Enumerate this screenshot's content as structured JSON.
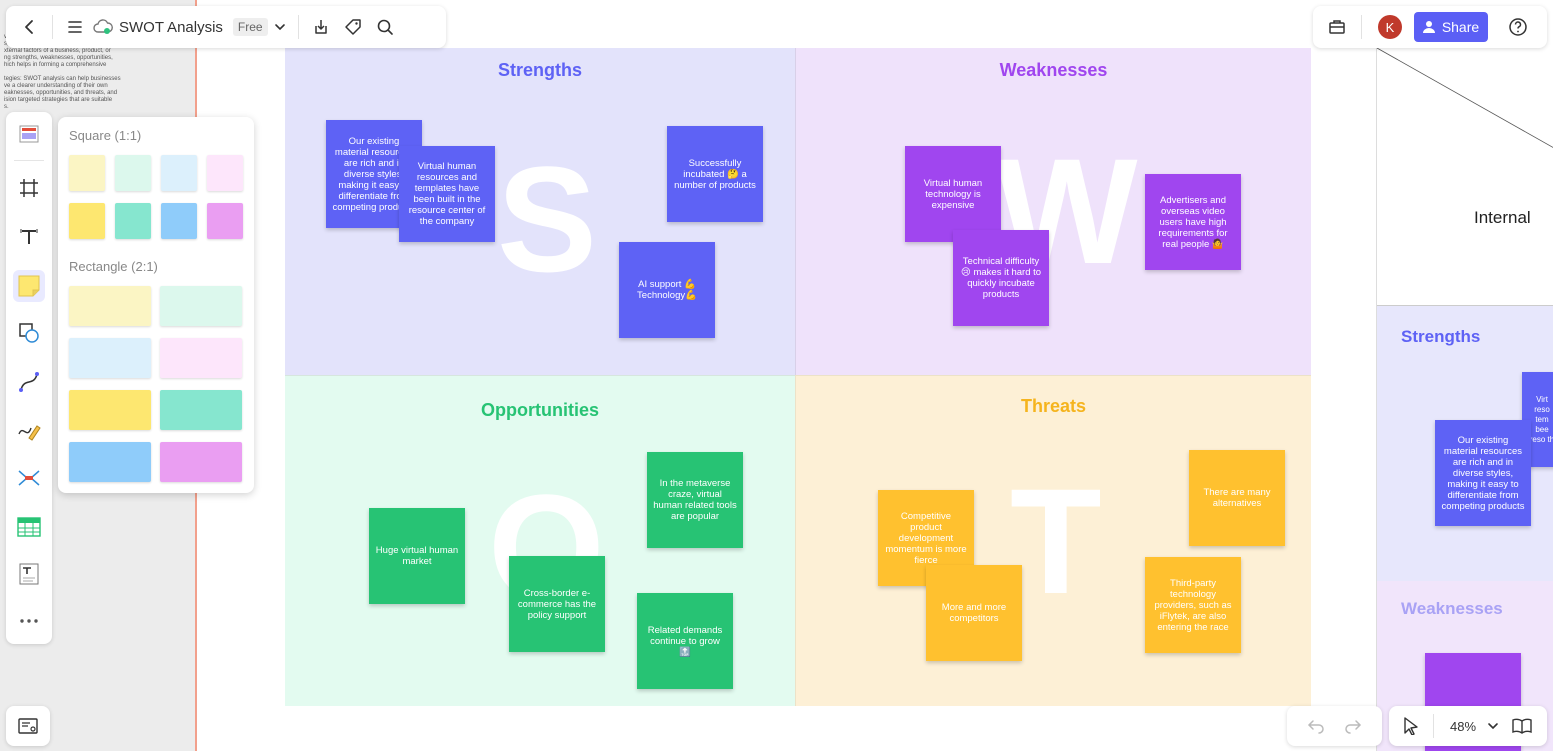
{
  "colors": {
    "accent": "#5b5ff5",
    "strengths_bg": "#e3e3fb",
    "weaknesses_bg": "#efe2fb",
    "opportunities_bg": "#e3fbf0",
    "threats_bg": "#fdf0d6",
    "strengths_note": "#5e62f5",
    "weaknesses_note": "#a046ef",
    "opportunities_note": "#27c374",
    "threats_note": "#ffc12f"
  },
  "doc_strip": {
    "lines": [
      "ve",
      "s,",
      "xternal factors of a business, product, or",
      "ng strengths, weaknesses, opportunities,",
      "hich helps in forming a comprehensive",
      "",
      "tegies: SWOT analysis can help businesses",
      "ve a clearer understanding of their own",
      "eaknesses, opportunities, and threats, and",
      "ision targeted strategies that are suitable",
      "s."
    ]
  },
  "topbar": {
    "title": "SWOT Analysis",
    "plan_badge": "Free",
    "icons": [
      "back-arrow-icon",
      "menu-icon",
      "cloud-sync-icon",
      "chevron-down-icon",
      "download-icon",
      "tag-icon",
      "search-icon"
    ]
  },
  "rightbar": {
    "avatar_initial": "K",
    "share_label": "Share"
  },
  "palette": {
    "square_title": "Square (1:1)",
    "rect_title": "Rectangle (2:1)",
    "square_colors": [
      "#fbf5c4",
      "#dcf8ed",
      "#dcf0fc",
      "#fde6fb",
      "#fde770",
      "#86e6cf",
      "#8fccfa",
      "#ea9ef2"
    ],
    "rect_colors": [
      "#fbf5c4",
      "#dcf8ed",
      "#dcf0fc",
      "#fde6fb",
      "#fde770",
      "#86e6cf",
      "#8fccfa",
      "#ea9ef2"
    ]
  },
  "quadrants": {
    "strengths": {
      "title": "Strengths",
      "letter": "S",
      "notes": [
        "Our existing material resources are rich and in diverse styles, making it easy to differentiate from competing products",
        "Virtual human resources and templates have been built in the resource center of the company",
        "Successfully incubated 🤔 a number of products",
        "AI support 💪Technology💪"
      ]
    },
    "weaknesses": {
      "title": "Weaknesses",
      "letter": "W",
      "notes": [
        "Virtual human technology is expensive",
        "Technical difficulty 😢 makes it hard to quickly incubate products",
        "Advertisers and overseas video users have high requirements for real people 🤷"
      ]
    },
    "opportunities": {
      "title": "Opportunities",
      "letter": "O",
      "notes": [
        "Huge virtual human market",
        "Cross-border e-commerce has the policy support",
        "In the metaverse craze, virtual human related tools are popular",
        "Related demands continue to grow 🔝"
      ]
    },
    "threats": {
      "title": "Threats",
      "letter": "T",
      "notes": [
        "Competitive product development momentum is more fierce",
        "More and more competitors",
        "There are many alternatives",
        "Third-party technology providers, such as iFlytek, are also entering the race"
      ]
    }
  },
  "preview": {
    "internal_label": "Internal",
    "strengths_label": "Strengths",
    "weaknesses_label": "Weaknesses",
    "note_text": "Our existing material resources are rich and in diverse styles, making it easy to differentiate from competing products",
    "note_text_partial": "Virt reso tem bee reso th"
  },
  "zoom": {
    "level": "48%"
  }
}
